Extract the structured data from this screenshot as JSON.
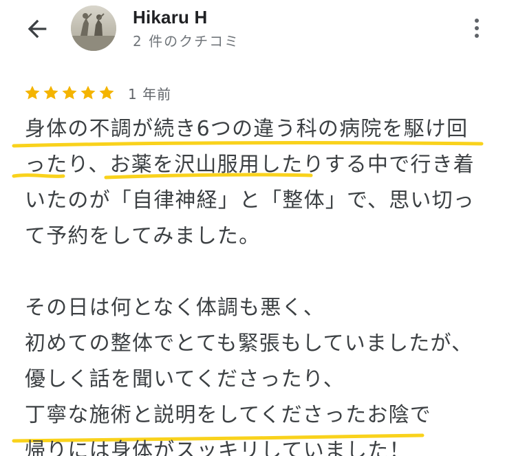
{
  "header": {
    "reviewer_name": "Hikaru H",
    "review_count": "2 件のクチコミ",
    "back_icon": "arrow-back-icon",
    "more_icon": "more-vert-icon"
  },
  "rating": {
    "stars": 5,
    "max_stars": 5,
    "time_ago": "1 年前",
    "star_color": "#f4b400"
  },
  "review": {
    "lines": [
      "身体の不調が続き6つの違う科の病院を駆け回",
      "ったり、お薬を沢山服用したりする中で行き着",
      "いたのが「自律神経」と「整体」で、思い切っ",
      "て予約をしてみました。",
      "",
      "その日は何となく体調も悪く、",
      "初めての整体でとても緊張もしていましたが、",
      "優しく話を聞いてくださったり、",
      "丁寧な施術と説明をしてくださったお陰で",
      "帰りには身体がスッキリしていました！"
    ]
  },
  "colors": {
    "highlight": "#f9d21c",
    "text": "#3c4043",
    "secondary_text": "#70757a"
  }
}
